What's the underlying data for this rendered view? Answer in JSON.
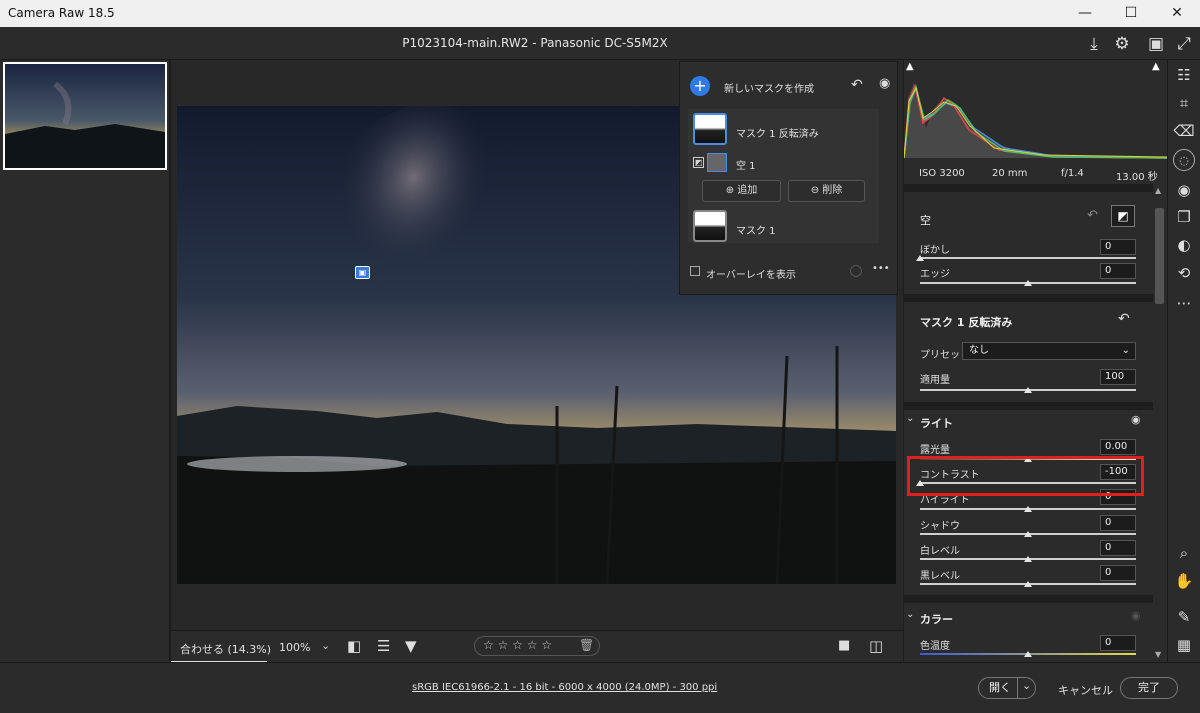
{
  "window": {
    "title": "Camera Raw 18.5",
    "minimize": "—",
    "maximize": "☐",
    "close": "✕"
  },
  "header": {
    "filename": "P1023104-main.RW2  -  Panasonic DC-S5M2X"
  },
  "mask_panel": {
    "create_label": "新しいマスクを作成",
    "mask_inverted_label": "マスク 1 反転済み",
    "sky_label": "空 1",
    "add_label": "追加",
    "subtract_label": "削除",
    "mask1_label": "マスク 1",
    "overlay_label": "オーバーレイを表示",
    "more": "•••"
  },
  "histogram": {
    "iso": "ISO 3200",
    "focal": "20 mm",
    "aperture": "f/1.4",
    "shutter": "13.00 秒"
  },
  "panel": {
    "sky_header": "空",
    "feather": {
      "label": "ぼかし",
      "value": "0"
    },
    "edge": {
      "label": "エッジ",
      "value": "0"
    },
    "mask_header": "マスク 1 反転済み",
    "preset": {
      "label": "プリセット",
      "value": "なし"
    },
    "amount": {
      "label": "適用量",
      "value": "100"
    },
    "light_header": "ライト",
    "exposure": {
      "label": "露光量",
      "value": "0.00"
    },
    "contrast": {
      "label": "コントラスト",
      "value": "-100"
    },
    "highlights": {
      "label": "ハイライト",
      "value": "0"
    },
    "shadows": {
      "label": "シャドウ",
      "value": "0"
    },
    "whites": {
      "label": "白レベル",
      "value": "0"
    },
    "blacks": {
      "label": "黒レベル",
      "value": "0"
    },
    "color_header": "カラー",
    "temp": {
      "label": "色温度",
      "value": "0"
    }
  },
  "slider_levels": {
    "feather": 0.0,
    "edge": 0.5,
    "amount": 0.5,
    "exposure": 0.5,
    "contrast": 0.0,
    "highlights": 0.5,
    "shadows": 0.5,
    "whites": 0.5,
    "blacks": 0.5,
    "temp": 0.5
  },
  "bottombar": {
    "fit_label": "合わせる (14.3%)",
    "zoom_label": "100%",
    "stars": "☆ ☆ ☆ ☆ ☆"
  },
  "footer": {
    "info_link": "sRGB IEC61966-2.1 - 16 bit - 6000 x 4000 (24.0MP) - 300 ppi",
    "open_label": "開く",
    "cancel_label": "キャンセル",
    "done_label": "完了"
  },
  "colors": {
    "highlight_box": "#e0211b",
    "accent_blue": "#2f7ae5"
  }
}
